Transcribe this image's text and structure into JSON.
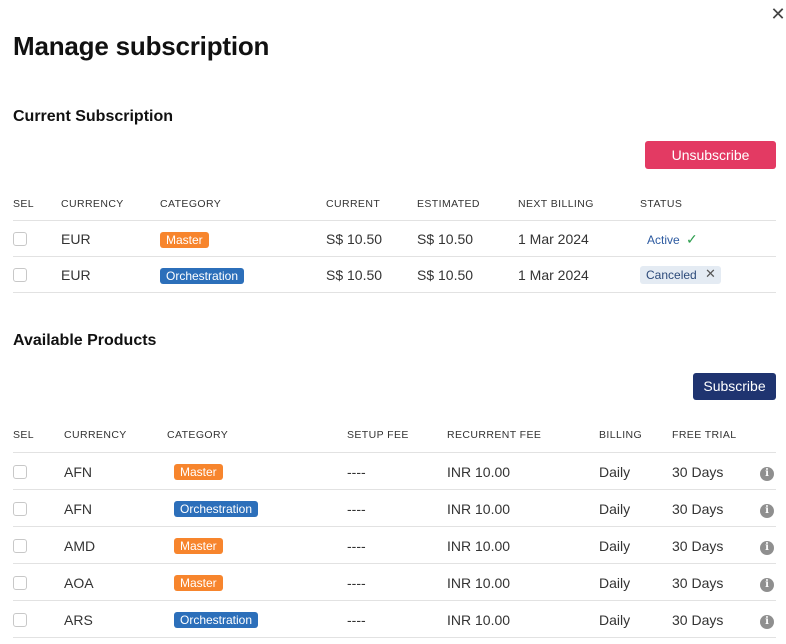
{
  "dialog": {
    "title": "Manage subscription",
    "close_glyph": "✕"
  },
  "current": {
    "section_title": "Current Subscription",
    "action_label": "Unsubscribe",
    "headers": [
      "SEL",
      "CURRENCY",
      "CATEGORY",
      "CURRENT",
      "ESTIMATED",
      "NEXT BILLING",
      "STATUS"
    ],
    "rows": [
      {
        "currency": "EUR",
        "category": "Master",
        "current": "S$ 10.50",
        "estimated": "S$ 10.50",
        "next_billing": "1 Mar 2024",
        "status": "Active",
        "status_glyph": "✓"
      },
      {
        "currency": "EUR",
        "category": "Orchestration",
        "current": "S$ 10.50",
        "estimated": "S$ 10.50",
        "next_billing": "1 Mar 2024",
        "status": "Canceled",
        "status_glyph": "✕"
      }
    ]
  },
  "available": {
    "section_title": "Available Products",
    "action_label": "Subscribe",
    "headers": [
      "SEL",
      "CURRENCY",
      "CATEGORY",
      "SETUP FEE",
      "RECURRENT FEE",
      "BILLING",
      "FREE TRIAL"
    ],
    "info_glyph": "i",
    "rows": [
      {
        "currency": "AFN",
        "category": "Master",
        "setup_fee": "----",
        "recurrent_fee": "INR 10.00",
        "billing": "Daily",
        "free_trial": "30 Days"
      },
      {
        "currency": "AFN",
        "category": "Orchestration",
        "setup_fee": "----",
        "recurrent_fee": "INR 10.00",
        "billing": "Daily",
        "free_trial": "30 Days"
      },
      {
        "currency": "AMD",
        "category": "Master",
        "setup_fee": "----",
        "recurrent_fee": "INR 10.00",
        "billing": "Daily",
        "free_trial": "30 Days"
      },
      {
        "currency": "AOA",
        "category": "Master",
        "setup_fee": "----",
        "recurrent_fee": "INR 10.00",
        "billing": "Daily",
        "free_trial": "30 Days"
      },
      {
        "currency": "ARS",
        "category": "Orchestration",
        "setup_fee": "----",
        "recurrent_fee": "INR 10.00",
        "billing": "Daily",
        "free_trial": "30 Days"
      }
    ]
  },
  "colors": {
    "unsubscribe": "#e33a63",
    "subscribe": "#1f3470",
    "master_badge": "#f7852d",
    "orchestration_badge": "#2c6fba",
    "active_check": "#2e9e4f"
  }
}
